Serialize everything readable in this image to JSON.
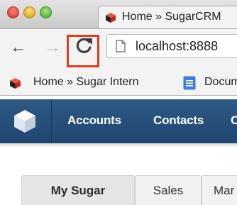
{
  "browser": {
    "tab_title": "Home » SugarCRM",
    "url": "localhost:8888",
    "buttons": {
      "back": "←",
      "forward": "→"
    },
    "bookmarks": [
      {
        "label": "Home » Sugar Intern",
        "icon": "sugarcrm-cube-icon"
      },
      {
        "label": "Docum",
        "icon": "document-icon"
      }
    ]
  },
  "annotation": {
    "color": "#e13b1d"
  },
  "nav": {
    "items": [
      "Accounts",
      "Contacts",
      "C"
    ]
  },
  "dashboard_tabs": [
    "My Sugar",
    "Sales",
    "Mar"
  ],
  "colors": {
    "navbar": "#244d78",
    "logo_red": "#c8281c",
    "doc_blue": "#3e7ee0"
  }
}
